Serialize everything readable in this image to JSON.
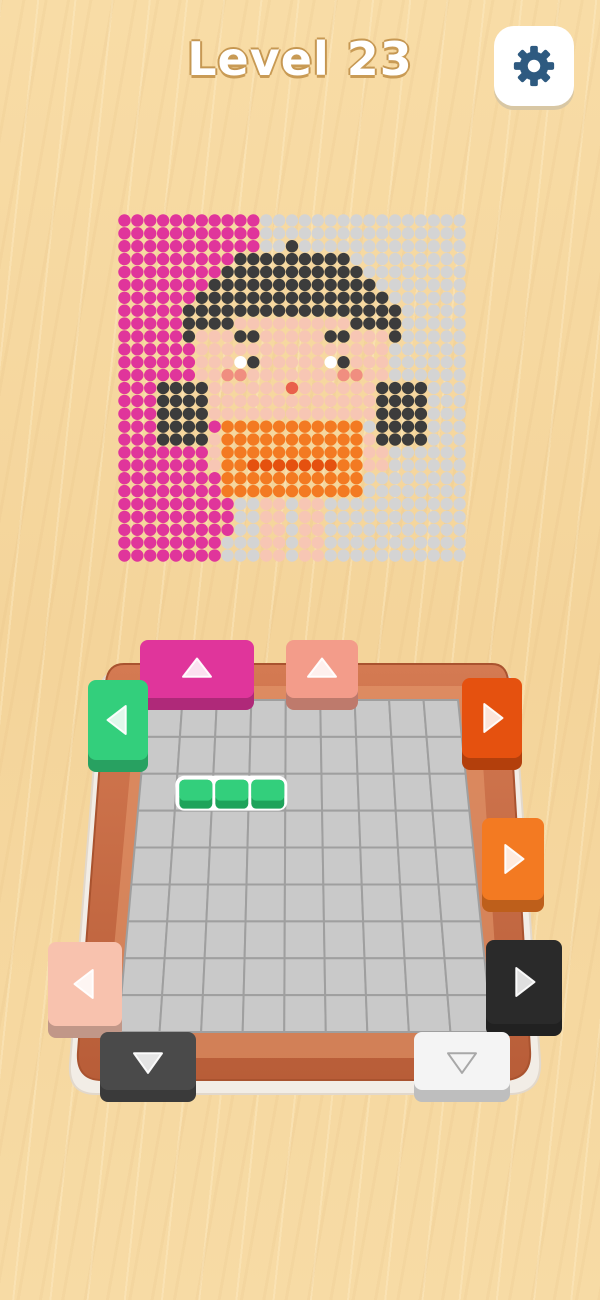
{
  "header": {
    "level_label": "Level 23",
    "settings_icon": "gear-icon"
  },
  "colors": {
    "background": "#f6d9a4",
    "magenta": "#e0359b",
    "salmon": "#f39c8a",
    "green": "#33cf7c",
    "dark_orange": "#e5510f",
    "orange": "#f37a22",
    "skin": "#f8c2ae",
    "black": "#2a2a2a",
    "dark_gray": "#4a4a4a",
    "white": "#f4f4f4",
    "gray_grid": "#cfcfcf",
    "board_frame": "#c96b44"
  },
  "pixel_art": {
    "description_icon": "girl-portrait-bead-picture",
    "columns": 27,
    "rows": 27
  },
  "board": {
    "grid_columns": 9,
    "grid_rows": 9,
    "active_piece": {
      "color": "green",
      "length": 3
    },
    "shooters": [
      {
        "id": "top-magenta",
        "color": "magenta",
        "direction": "up"
      },
      {
        "id": "top-salmon",
        "color": "salmon",
        "direction": "up"
      },
      {
        "id": "left-green",
        "color": "green",
        "direction": "left"
      },
      {
        "id": "right-dark-orange",
        "color": "dark_orange",
        "direction": "right"
      },
      {
        "id": "right-orange",
        "color": "orange",
        "direction": "right"
      },
      {
        "id": "left-skin",
        "color": "skin",
        "direction": "left"
      },
      {
        "id": "right-black",
        "color": "black",
        "direction": "right"
      },
      {
        "id": "bottom-dark-gray",
        "color": "dark_gray",
        "direction": "down"
      },
      {
        "id": "bottom-white",
        "color": "white",
        "direction": "down"
      }
    ]
  }
}
